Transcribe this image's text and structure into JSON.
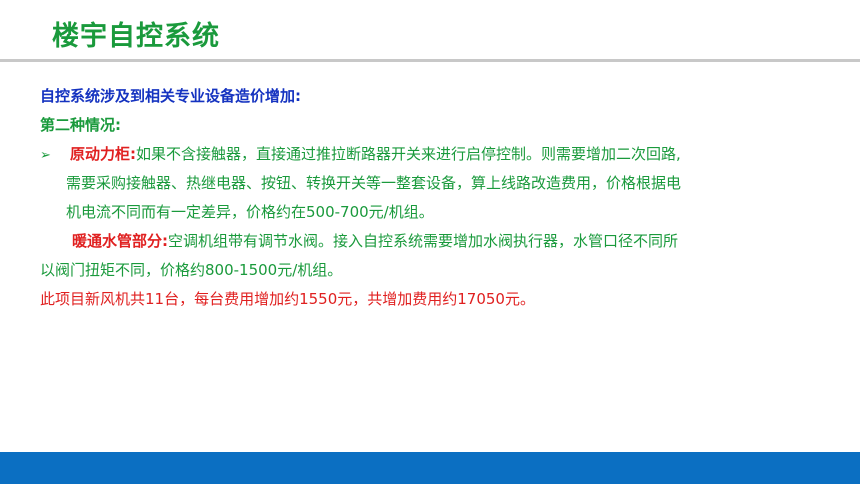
{
  "slide": {
    "title": "楼宇自控系统"
  },
  "content": {
    "intro": "自控系统涉及到相关专业设备造价增加:",
    "case_heading": "第二种情况:",
    "bullet_glyph": "➢",
    "item1_label": "原动力柜:",
    "item1_line1": "如果不含接触器，直接通过推拉断路器开关来进行启停控制。则需要增加二次回路,",
    "item1_line2": "需要采购接触器、热继电器、按钮、转换开关等一整套设备，算上线路改造费用，价格根据电",
    "item1_line3": "机电流不同而有一定差异，价格约在500-700元/机组。",
    "item2_label": "暖通水管部分:",
    "item2_line1": "空调机组带有调节水阀。接入自控系统需要增加水阀执行器，水管口径不同所",
    "item2_line2": "以阀门扭矩不同，价格约800-1500元/机组。",
    "summary": "此项目新风机共11台，每台费用增加约1550元，共增加费用约17050元。"
  },
  "colors": {
    "title_green": "#1a9a3c",
    "heading_blue": "#1533c0",
    "highlight_red": "#e02020",
    "footer_blue": "#0b6fc2"
  }
}
